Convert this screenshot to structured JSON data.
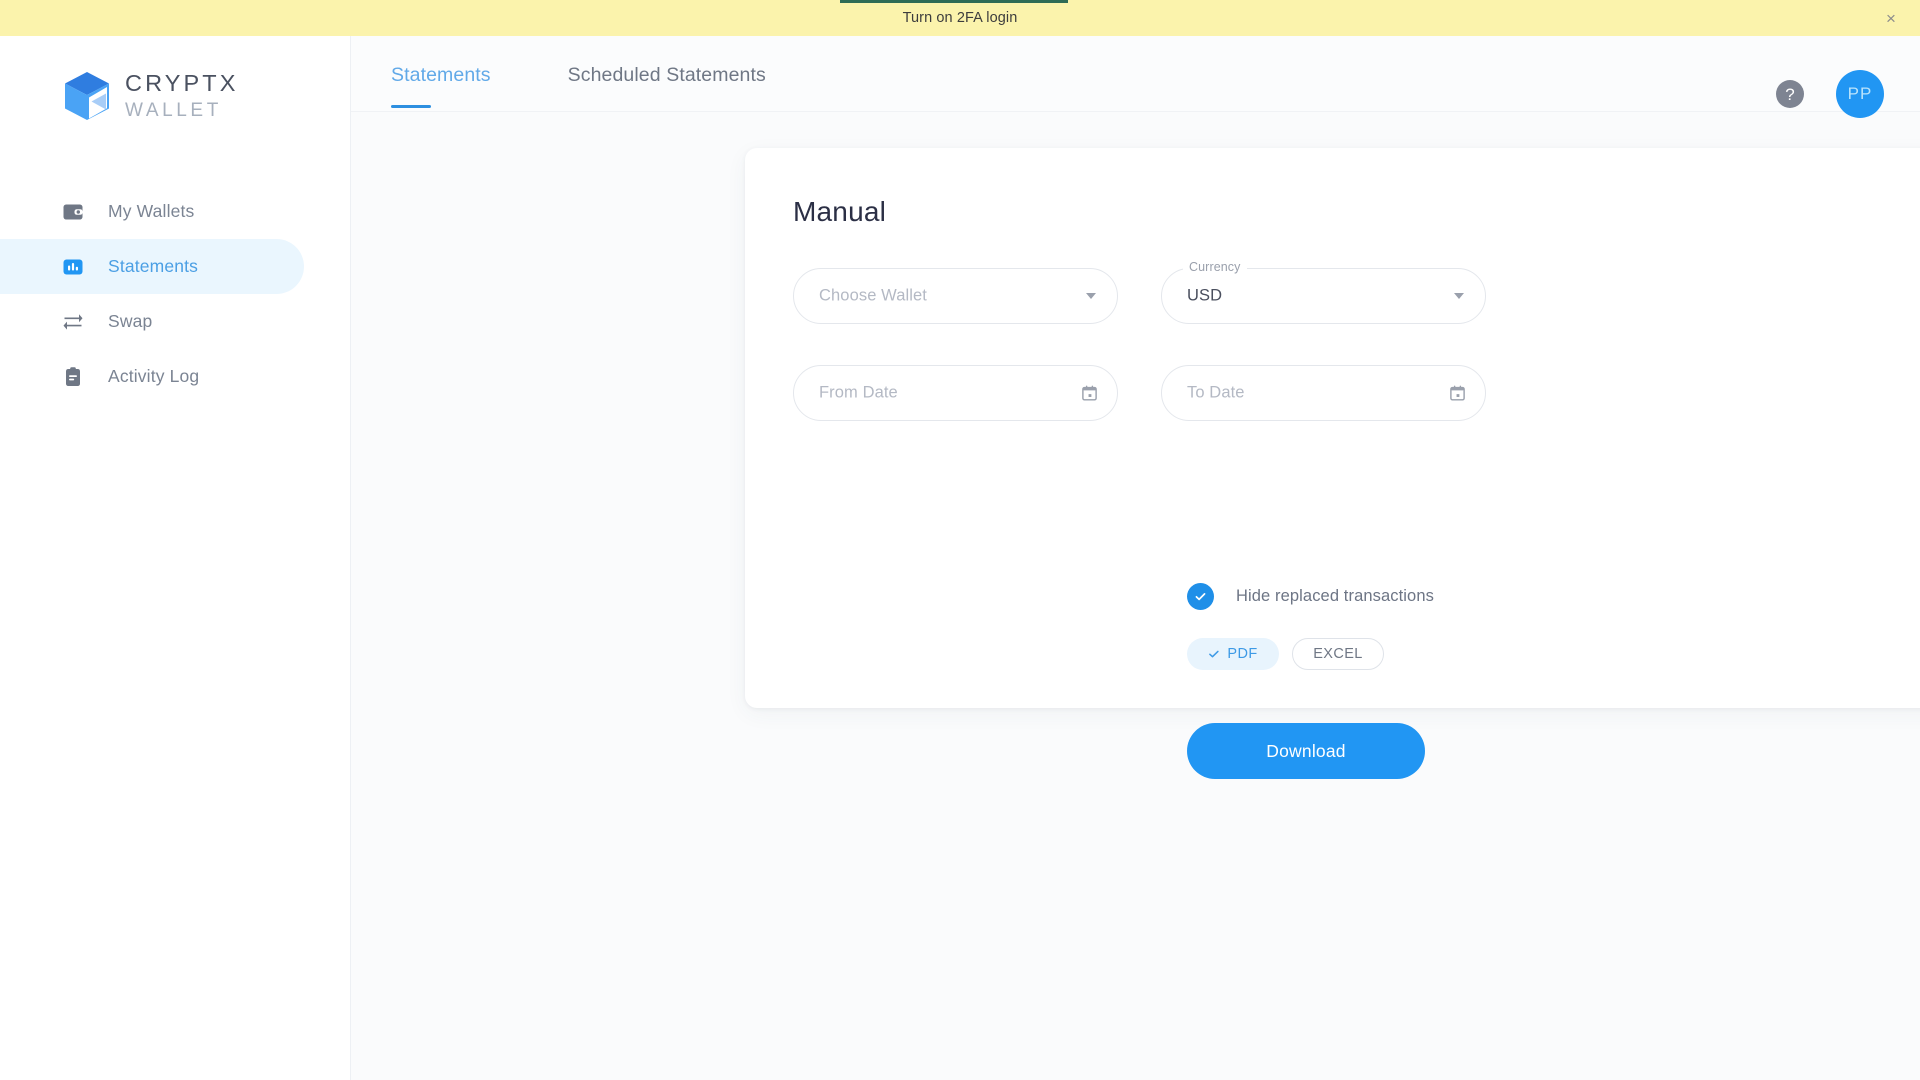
{
  "banner": {
    "message": "Turn on 2FA login",
    "close_label": "×",
    "bg_color": "#fbf3ac",
    "progress_color": "#2e6b55"
  },
  "brand": {
    "name": "CRYPTX",
    "sub": "WALLET",
    "mark": "cube-logo",
    "accent": "#2196f3"
  },
  "sidebar": {
    "items": [
      {
        "label": "My Wallets",
        "icon": "wallet-icon",
        "active": false
      },
      {
        "label": "Statements",
        "icon": "bar-chart-icon",
        "active": true
      },
      {
        "label": "Swap",
        "icon": "swap-arrows-icon",
        "active": false
      },
      {
        "label": "Activity Log",
        "icon": "clipboard-icon",
        "active": false
      }
    ]
  },
  "topbar": {
    "tabs": [
      {
        "label": "Statements",
        "active": true
      },
      {
        "label": "Scheduled Statements",
        "active": false
      }
    ],
    "help_glyph": "?",
    "avatar_initials": "PP"
  },
  "main": {
    "card_title": "Manual",
    "fields": {
      "wallet": {
        "placeholder": "Choose Wallet",
        "value": "",
        "legend": ""
      },
      "currency": {
        "legend": "Currency",
        "value": "USD"
      },
      "from_date": {
        "placeholder": "From Date",
        "value": ""
      },
      "to_date": {
        "placeholder": "To Date",
        "value": ""
      }
    },
    "checkbox": {
      "label": "Hide replaced transactions",
      "checked": true,
      "check_glyph": "✓"
    },
    "formats": [
      {
        "label": "PDF",
        "selected": true,
        "check_glyph": "✓"
      },
      {
        "label": "EXCEL",
        "selected": false,
        "check_glyph": ""
      }
    ],
    "download_label": "Download"
  }
}
